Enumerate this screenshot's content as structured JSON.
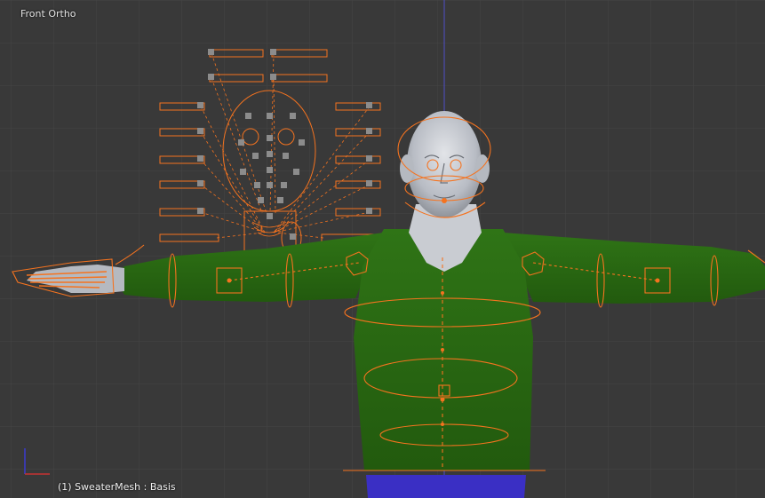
{
  "viewport": {
    "view_name": "Front Ortho",
    "active_object": "(1) SweaterMesh : Basis"
  },
  "colors": {
    "background": "#393939",
    "grid_line": "#4a4a4a",
    "vertical_axis": "#4f4fc8",
    "rig_selected": "#f5731f",
    "sweater": "#2a6a12",
    "skin": "#c9ccd2",
    "trousers": "#3a2fc4",
    "bone_square": "#8c8c8c",
    "axis_x": "#c83232",
    "axis_z": "#3a3ad0"
  },
  "icons": {
    "axis_gizmo": "axes-gizmo-icon",
    "face_rig": "face-rig-panel-icon"
  }
}
